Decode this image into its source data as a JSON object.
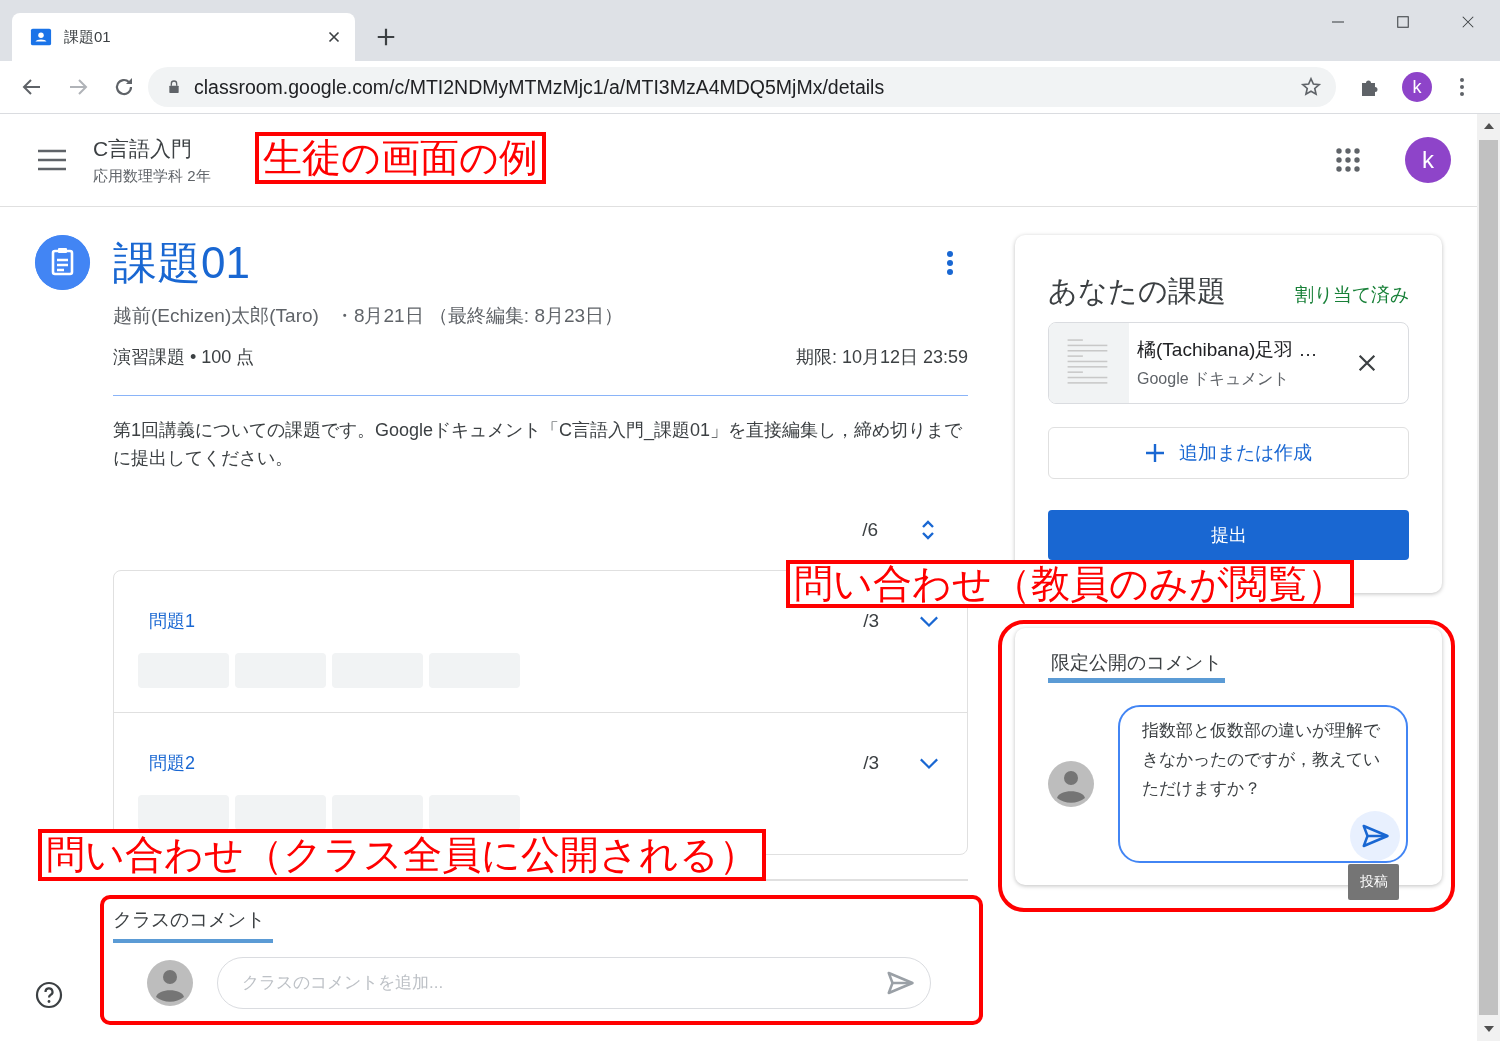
{
  "browser": {
    "tabs": [
      {
        "title": "課題01",
        "selected": true
      }
    ],
    "url": "classroom.google.com/c/MTI2NDMyMTMzMjc1/a/MTI3MzA4MDQ5MjMx/details",
    "profile_initial": "k"
  },
  "header": {
    "course": "C言語入門",
    "section": "応用数理学科 2年",
    "avatar_initial": "k"
  },
  "assignment": {
    "title": "課題01",
    "author": "越前(Echizen)太郎(Taro)",
    "dates": "・8月21日 （最終編集: 8月23日）",
    "category": "演習課題 • 100 点",
    "due": "期限: 10月12日 23:59",
    "description": "第1回講義についての課題です。Googleドキュメント「C言語入門_課題01」を直接編集し，締め切りまでに提出してください。",
    "rubric_total": "/6",
    "rubric": [
      {
        "title": "問題1",
        "points": "/3"
      },
      {
        "title": "問題2",
        "points": "/3"
      }
    ]
  },
  "class_comments": {
    "label": "クラスのコメント",
    "placeholder": "クラスのコメントを追加..."
  },
  "your_work": {
    "title": "あなたの課題",
    "status": "割り当て済み",
    "attachment": {
      "name": "橘(Tachibana)足羽 …",
      "type": "Google ドキュメント"
    },
    "add_button": "追加または作成",
    "submit_button": "提出"
  },
  "private_comments": {
    "label": "限定公開のコメント",
    "draft": "指数部と仮数部の違いが理解できなかったのですが，教えていただけますか？",
    "tooltip": "投稿"
  },
  "annotations": [
    {
      "kind": "label",
      "text": "生徒の画面の例"
    },
    {
      "kind": "label",
      "text": "問い合わせ（教員のみが閲覧）"
    },
    {
      "kind": "outline"
    },
    {
      "kind": "label",
      "text": "問い合わせ（クラス全員に公開される）"
    },
    {
      "kind": "outline"
    }
  ]
}
